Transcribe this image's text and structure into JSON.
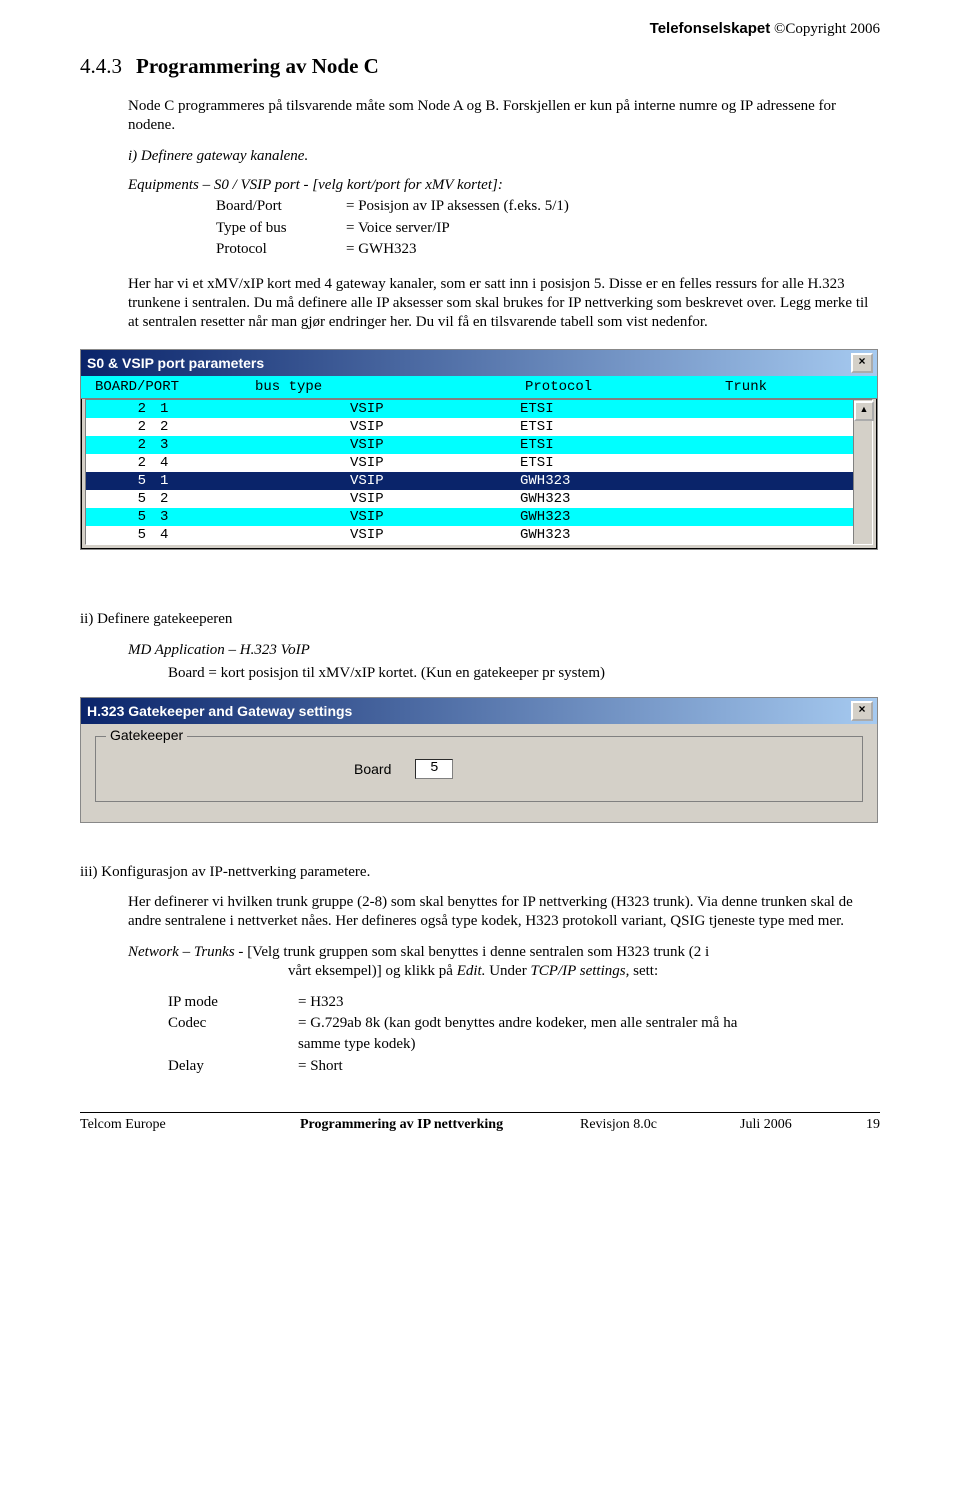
{
  "header": {
    "brand": "Telefonselskapet",
    "copyright": " ©Copyright 2006"
  },
  "section": {
    "number": "4.4.3",
    "title": "Programmering av Node C"
  },
  "intro1": "Node C programmeres på tilsvarende måte som Node A og B.  Forskjellen er kun på interne numre og IP adressene for nodene.",
  "step_i": "i) Definere gateway kanalene.",
  "equip_line": "Equipments – S0 / VSIP port -  [velg kort/port for xMV kortet]:",
  "equip": {
    "k1": "Board/Port",
    "v1": "= Posisjon av IP aksessen (f.eks. 5/1)",
    "k2": "Type of bus",
    "v2": "= Voice server/IP",
    "k3": "Protocol",
    "v3": "=  GWH323"
  },
  "para2": "Her har vi et xMV/xIP  kort med 4 gateway kanaler, som er satt inn i posisjon 5.  Disse er en felles ressurs for alle H.323 trunkene i sentralen.  Du må definere alle IP aksesser som skal brukes for IP nettverking som beskrevet over.  Legg merke til at sentralen resetter når man gjør endringer her.  Du vil få en tilsvarende tabell som vist nedenfor.",
  "win1": {
    "title": "S0 & VSIP port parameters",
    "headers": {
      "bp": "BOARD/PORT",
      "bt": "bus type",
      "pr": "Protocol",
      "tk": "Trunk"
    },
    "rows": [
      {
        "b": "2",
        "p": "1",
        "bt": "VSIP",
        "pr": "ETSI",
        "style": "cyan"
      },
      {
        "b": "2",
        "p": "2",
        "bt": "VSIP",
        "pr": "ETSI",
        "style": "plain"
      },
      {
        "b": "2",
        "p": "3",
        "bt": "VSIP",
        "pr": "ETSI",
        "style": "cyan"
      },
      {
        "b": "2",
        "p": "4",
        "bt": "VSIP",
        "pr": "ETSI",
        "style": "plain"
      },
      {
        "b": "5",
        "p": "1",
        "bt": "VSIP",
        "pr": "GWH323",
        "style": "sel"
      },
      {
        "b": "5",
        "p": "2",
        "bt": "VSIP",
        "pr": "GWH323",
        "style": "plain"
      },
      {
        "b": "5",
        "p": "3",
        "bt": "VSIP",
        "pr": "GWH323",
        "style": "cyan"
      },
      {
        "b": "5",
        "p": "4",
        "bt": "VSIP",
        "pr": "GWH323",
        "style": "plain"
      }
    ]
  },
  "step_ii": "ii) Definere gatekeeperen",
  "md_app": "MD Application – H.323 VoIP",
  "board_line": "Board = kort posisjon til xMV/xIP  kortet.  (Kun en gatekeeper pr system)",
  "win2": {
    "title": "H.323 Gatekeeper and Gateway settings",
    "group": "Gatekeeper",
    "board_label": "Board",
    "board_value": "5"
  },
  "step_iii": "iii) Konfigurasjon av IP-nettverking parametere.",
  "para3": "Her definerer vi hvilken trunk gruppe (2-8) som skal benyttes for IP nettverking (H323 trunk).  Via denne trunken skal de andre sentralene i nettverket nåes.  Her defineres også type kodek, H323 protokoll variant, QSIG tjeneste type med mer.",
  "network_trunks_label": "Network – Trunks -   ",
  "network_trunks_1": "[Velg trunk gruppen som skal benyttes i denne sentralen som H323 trunk (2 i",
  "network_trunks_2": "vårt  eksempel)] og klikk på ",
  "network_trunks_edit": "Edit.",
  "network_trunks_under": " Under ",
  "network_trunks_tcp": "TCP/IP settings,",
  "network_trunks_sett": " sett:",
  "settings": {
    "k1": "IP mode",
    "v1": "= H323",
    "k2": "Codec",
    "v2": "= G.729ab 8k  (kan godt benyttes andre kodeker, men alle sentraler må ha",
    "v2b": "samme type kodek)",
    "k3": "Delay",
    "v3": "= Short"
  },
  "footer": {
    "f1": "Telcom Europe",
    "f2": "Programmering av IP nettverking",
    "f3": "Revisjon 8.0c",
    "f4": "Juli 2006",
    "f5": "19"
  }
}
